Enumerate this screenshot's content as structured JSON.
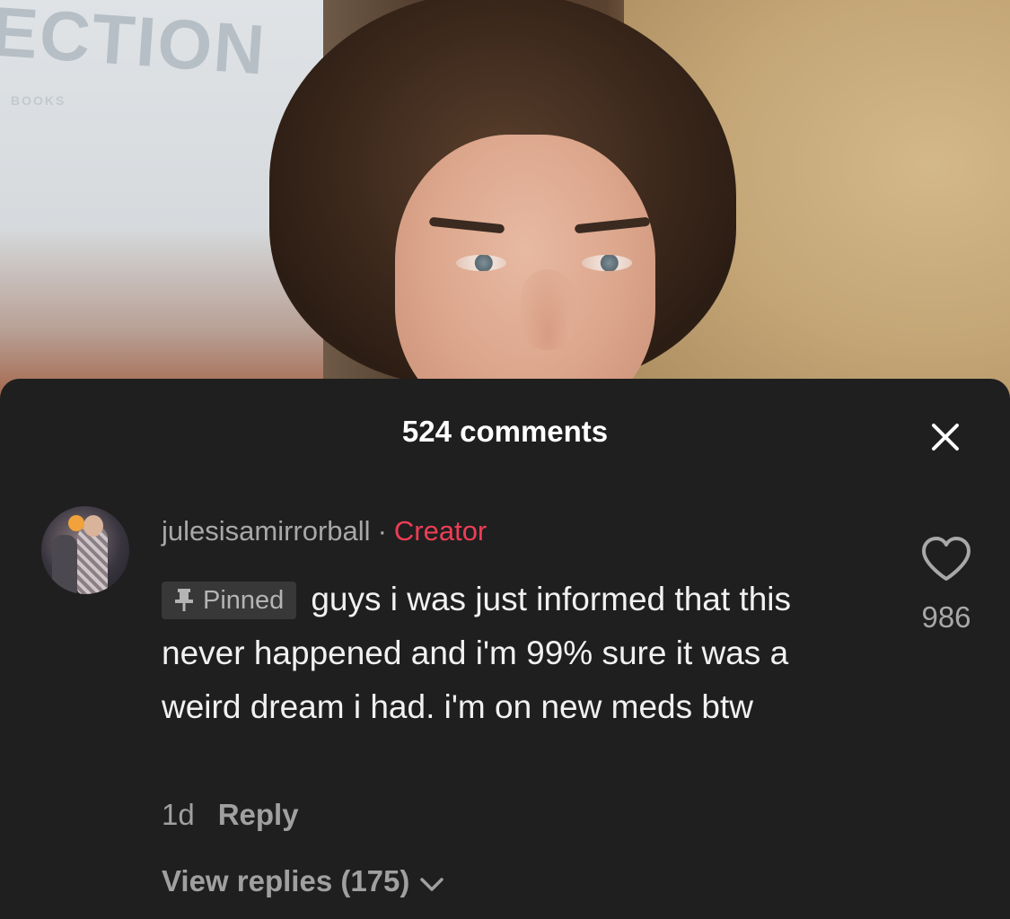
{
  "video": {
    "banner_text": "ECTION",
    "banner_subtext": "BOOKS"
  },
  "comments_sheet": {
    "title": "524 comments",
    "close_icon": "close-icon"
  },
  "comment": {
    "username": "julesisamirrorball",
    "separator": "·",
    "badge": "Creator",
    "pinned_label": "Pinned",
    "text": "guys i was just informed that this never happened and i'm 99% sure it was a weird dream i had. i'm on new meds btw",
    "timestamp": "1d",
    "reply_label": "Reply",
    "view_replies_label": "View replies (175)",
    "like_count": "986",
    "like_icon": "heart-outline-icon"
  },
  "colors": {
    "sheet_background": "#1f1f1f",
    "creator_badge": "#ec3e56",
    "primary_text": "#f1f1f1",
    "secondary_text": "#a8a8a8"
  }
}
